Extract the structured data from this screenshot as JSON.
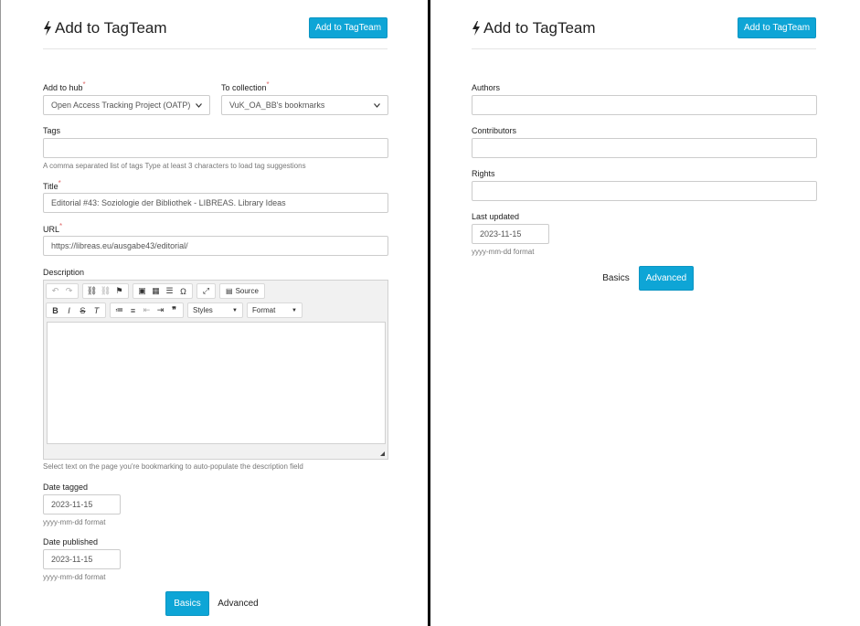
{
  "left": {
    "title": "Add to TagTeam",
    "add_button": "Add to TagTeam",
    "hub": {
      "label": "Add to hub",
      "req": "*",
      "value": "Open Access Tracking Project (OATP)"
    },
    "collection": {
      "label": "To collection",
      "req": "*",
      "value": "VuK_OA_BB's bookmarks"
    },
    "tags": {
      "label": "Tags",
      "value": "",
      "help": "A comma separated list of tags  Type at least 3 characters to load tag suggestions"
    },
    "title_field": {
      "label": "Title",
      "req": "*",
      "value": "Editorial #43: Soziologie der Bibliothek - LIBREAS. Library Ideas"
    },
    "url": {
      "label": "URL",
      "req": "*",
      "value": "https://libreas.eu/ausgabe43/editorial/"
    },
    "description": {
      "label": "Description",
      "help": "Select text on the page you're bookmarking to auto-populate the description field",
      "source_label": "Source",
      "styles_label": "Styles",
      "format_label": "Format"
    },
    "date_tagged": {
      "label": "Date tagged",
      "value": "2023-11-15",
      "help": "yyyy-mm-dd format"
    },
    "date_published": {
      "label": "Date published",
      "value": "2023-11-15",
      "help": "yyyy-mm-dd format"
    },
    "tabs": {
      "basics": "Basics",
      "advanced": "Advanced"
    }
  },
  "right": {
    "title": "Add to TagTeam",
    "add_button": "Add to TagTeam",
    "authors": {
      "label": "Authors",
      "value": ""
    },
    "contributors": {
      "label": "Contributors",
      "value": ""
    },
    "rights": {
      "label": "Rights",
      "value": ""
    },
    "last_updated": {
      "label": "Last updated",
      "value": "2023-11-15",
      "help": "yyyy-mm-dd format"
    },
    "tabs": {
      "basics": "Basics",
      "advanced": "Advanced"
    }
  },
  "colors": {
    "accent": "#0ea5d6",
    "required": "#e06c6c",
    "divider": "#000000"
  },
  "icons": [
    "bolt-icon",
    "undo-icon",
    "redo-icon",
    "link-icon",
    "unlink-icon",
    "anchor-icon",
    "image-icon",
    "table-icon",
    "horizontal-rule-icon",
    "special-char-icon",
    "maximize-icon",
    "source-icon",
    "bold-icon",
    "italic-icon",
    "strike-icon",
    "remove-format-icon",
    "numbered-list-icon",
    "bulleted-list-icon",
    "outdent-icon",
    "indent-icon",
    "blockquote-icon",
    "chevron-down-icon"
  ]
}
